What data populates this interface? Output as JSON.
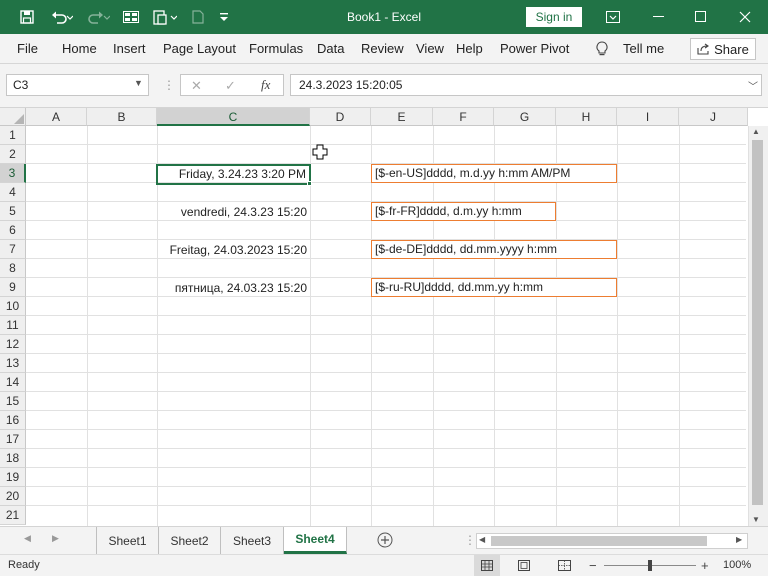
{
  "window": {
    "title": "Book1  -  Excel",
    "sign_in": "Sign in",
    "icons": [
      "save-icon",
      "undo-icon",
      "redo-icon",
      "form-icon",
      "paste-special-icon",
      "new-doc-icon",
      "customize-qa-icon",
      "ribbon-display-icon",
      "minimize-icon",
      "maximize-icon",
      "close-icon"
    ]
  },
  "menu": {
    "items": [
      "File",
      "Home",
      "Insert",
      "Page Layout",
      "Formulas",
      "Data",
      "Review",
      "View",
      "Help",
      "Power Pivot"
    ],
    "tell_me": "Tell me",
    "share": "Share"
  },
  "formula_bar": {
    "name_box": "C3",
    "formula": "24.3.2023  15:20:05",
    "fx_label": "fx"
  },
  "columns": [
    "A",
    "B",
    "C",
    "D",
    "E",
    "F",
    "G",
    "H",
    "I",
    "J"
  ],
  "rows": [
    "1",
    "2",
    "3",
    "4",
    "5",
    "6",
    "7",
    "8",
    "9",
    "10",
    "11",
    "12",
    "13",
    "14",
    "15",
    "16",
    "17",
    "18",
    "19",
    "20",
    "21"
  ],
  "selection": {
    "column": "C",
    "row": "3"
  },
  "cells": {
    "C3": "Friday, 3.24.23 3:20 PM",
    "C5": "vendredi, 24.3.23 15:20",
    "C7": "Freitag, 24.03.2023 15:20",
    "C9": "пятница, 24.03.23 15:20",
    "E3": "[$-en-US]dddd, m.d.yy h:mm AM/PM",
    "E5": "[$-fr-FR]dddd, d.m.yy h:mm",
    "E7": "[$-de-DE]dddd, dd.mm.yyyy h:mm",
    "E9": "[$-ru-RU]dddd, dd.mm.yy h:mm"
  },
  "sheets": {
    "tabs": [
      "Sheet1",
      "Sheet2",
      "Sheet3",
      "Sheet4"
    ],
    "active": "Sheet4"
  },
  "status": {
    "mode": "Ready",
    "zoom": "100%"
  },
  "colors": {
    "accent": "#217346",
    "format_border": "#ed7d31"
  }
}
